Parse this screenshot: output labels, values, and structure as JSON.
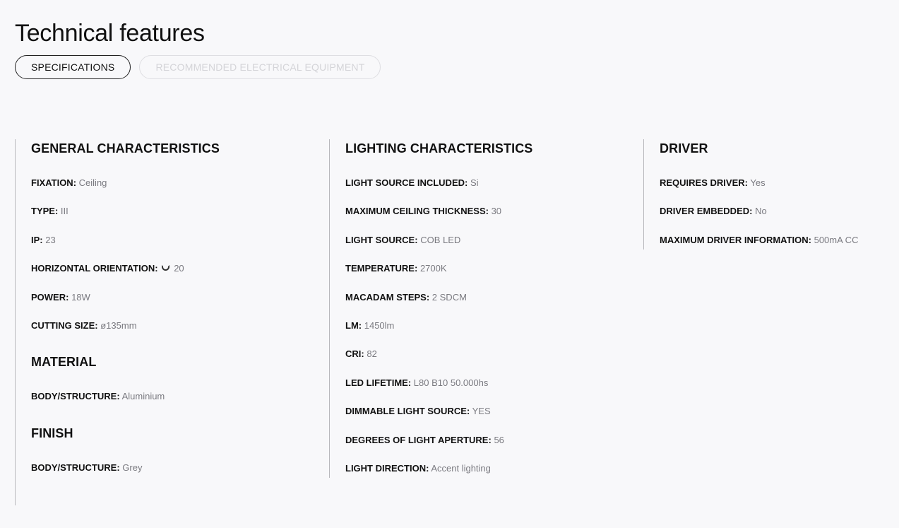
{
  "page": {
    "title": "Technical features"
  },
  "tabs": [
    {
      "label": "SPECIFICATIONS",
      "active": true
    },
    {
      "label": "RECOMMENDED ELECTRICAL EQUIPMENT",
      "active": false
    }
  ],
  "general": {
    "title": "GENERAL CHARACTERISTICS",
    "fixation": {
      "label": "FIXATION:",
      "value": "Ceiling"
    },
    "type": {
      "label": "TYPE:",
      "value": "III"
    },
    "ip": {
      "label": "IP:",
      "value": "23"
    },
    "orientation": {
      "label": "HORIZONTAL ORIENTATION:",
      "value": "20",
      "icon": "rotation-ring-icon"
    },
    "power": {
      "label": "POWER:",
      "value": "18W"
    },
    "cutting": {
      "label": "CUTTING SIZE:",
      "value": "ø135mm"
    }
  },
  "material": {
    "title": "MATERIAL",
    "body": {
      "label": "BODY/STRUCTURE:",
      "value": "Aluminium"
    }
  },
  "finish": {
    "title": "FINISH",
    "body": {
      "label": "BODY/STRUCTURE:",
      "value": "Grey"
    }
  },
  "lighting": {
    "title": "LIGHTING CHARACTERISTICS",
    "items": [
      {
        "label": "LIGHT SOURCE INCLUDED:",
        "value": "Si"
      },
      {
        "label": "MAXIMUM CEILING THICKNESS:",
        "value": "30"
      },
      {
        "label": "LIGHT SOURCE:",
        "value": "COB LED"
      },
      {
        "label": "TEMPERATURE:",
        "value": "2700K"
      },
      {
        "label": "MACADAM STEPS:",
        "value": "2 SDCM"
      },
      {
        "label": "LM:",
        "value": "1450lm"
      },
      {
        "label": "CRI:",
        "value": "82"
      },
      {
        "label": "LED LIFETIME:",
        "value": "L80 B10 50.000hs"
      },
      {
        "label": "DIMMABLE LIGHT SOURCE:",
        "value": "YES"
      },
      {
        "label": "DEGREES OF LIGHT APERTURE:",
        "value": "56"
      },
      {
        "label": "LIGHT DIRECTION:",
        "value": "Accent lighting"
      }
    ]
  },
  "driver": {
    "title": "DRIVER",
    "items": [
      {
        "label": "REQUIRES DRIVER:",
        "value": "Yes"
      },
      {
        "label": "DRIVER EMBEDDED:",
        "value": "No"
      },
      {
        "label": "MAXIMUM DRIVER INFORMATION:",
        "value": "500mA CC"
      }
    ]
  }
}
